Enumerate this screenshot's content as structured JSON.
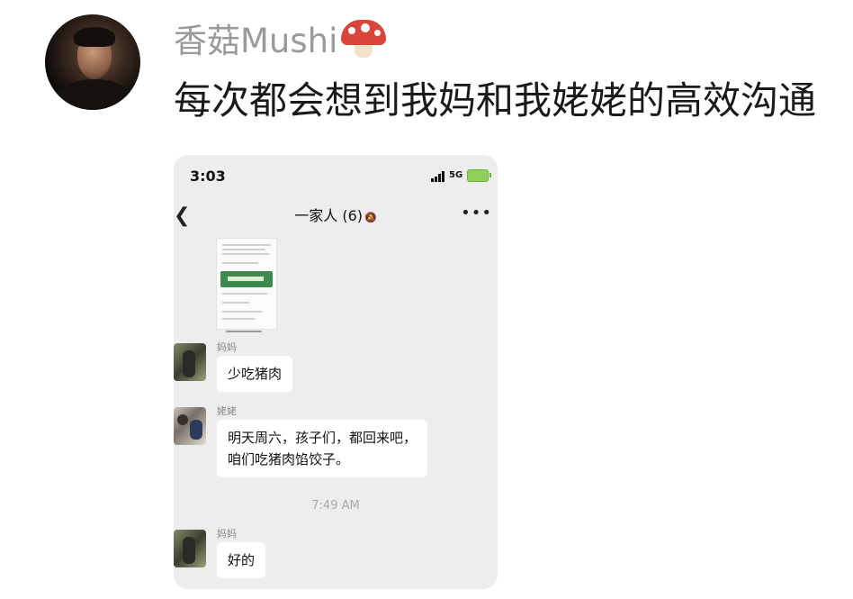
{
  "post": {
    "author": "香菇Mushi",
    "author_emoji": "mushroom-icon",
    "text": "每次都会想到我妈和我姥姥的高效沟通"
  },
  "screenshot": {
    "status_time": "3:03",
    "network": "5G",
    "chat_title": "一家人 (6)",
    "messages": [
      {
        "sender": "妈妈",
        "text": "少吃猪肉"
      },
      {
        "sender": "姥姥",
        "line1": "明天周六，孩子们，都回来吧，",
        "line2": "咱们吃猪肉馅饺子。"
      },
      {
        "timestamp": "7:49 AM"
      },
      {
        "sender": "妈妈",
        "text": "好的"
      }
    ]
  },
  "colors": {
    "author": "#9a9a9a",
    "chat_background": "#ededed",
    "bubble": "#ffffff",
    "battery": "#8fd05b"
  }
}
